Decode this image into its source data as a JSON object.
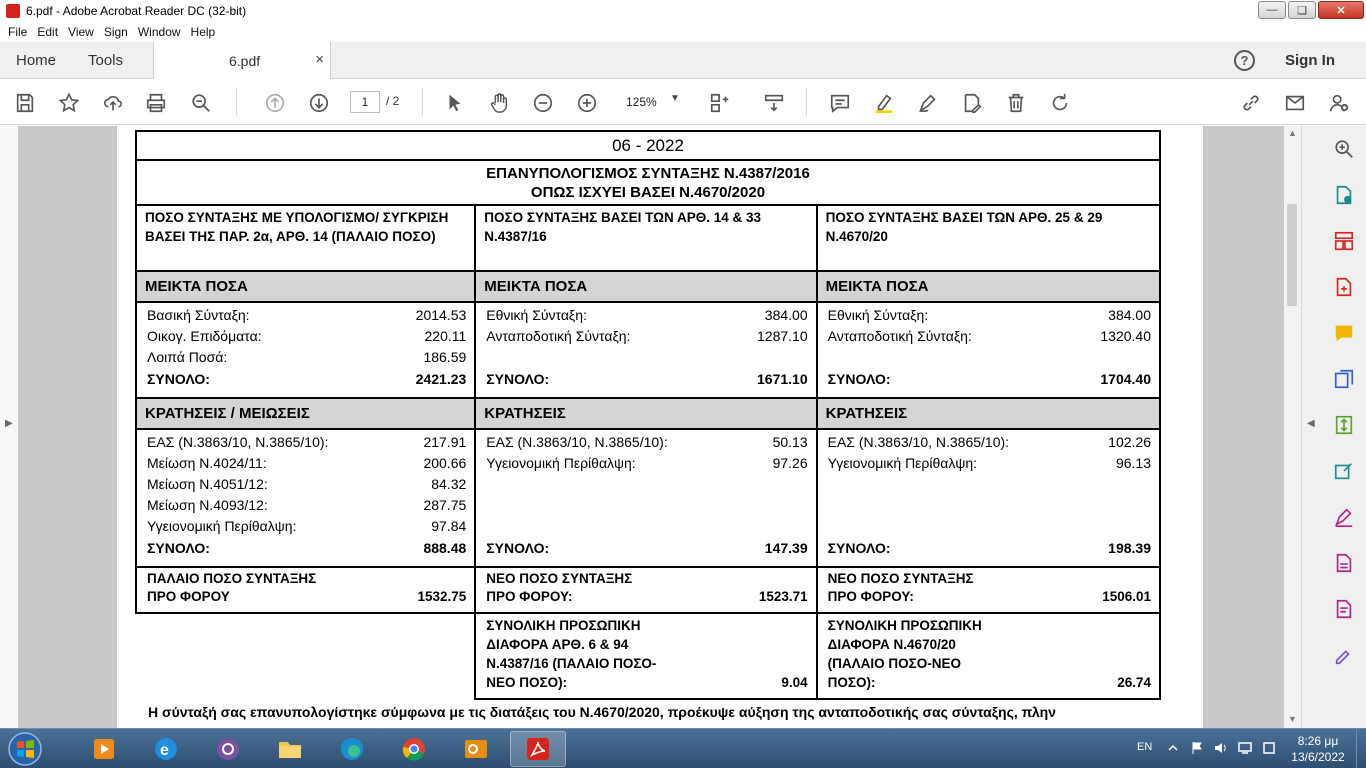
{
  "window": {
    "title": "6.pdf - Adobe Acrobat Reader DC (32-bit)"
  },
  "menu": [
    "File",
    "Edit",
    "View",
    "Sign",
    "Window",
    "Help"
  ],
  "tabs": {
    "home": "Home",
    "tools": "Tools",
    "document": "6.pdf",
    "close": "×"
  },
  "header": {
    "sign_in": "Sign In",
    "help": "?"
  },
  "toolbar": {
    "page_current": "1",
    "page_total": "/ 2",
    "zoom": "125%"
  },
  "form": {
    "date": "06 - 2022",
    "title_line1": "ΕΠΑΝΥΠΟΛΟΓΙΣΜΟΣ ΣΥΝΤΑΞΗΣ Ν.4387/2016",
    "title_line2": "ΟΠΩΣ ΙΣΧΥΕΙ ΒΑΣΕΙ Ν.4670/2020",
    "columns": [
      {
        "heading": "ΠΟΣΟ ΣΥΝΤΑΞΗΣ ΜΕ ΥΠΟΛΟΓΙΣΜΟ/ ΣΥΓΚΡΙΣΗ ΒΑΣΕΙ ΤΗΣ ΠΑΡ. 2α, ΑΡΘ. 14 (ΠΑΛΑΙΟ ΠΟΣΟ)",
        "gross_title": "ΜΕΙΚΤΑ ΠΟΣΑ",
        "gross": [
          {
            "label": "Βασική Σύνταξη:",
            "value": "2014.53"
          },
          {
            "label": "Οικογ. Επιδόματα:",
            "value": "220.11"
          },
          {
            "label": "Λοιπά Ποσά:",
            "value": "186.59"
          }
        ],
        "gross_total_label": "ΣΥΝΟΛΟ:",
        "gross_total": "2421.23",
        "deductions_title": "ΚΡΑΤΗΣΕΙΣ / ΜΕΙΩΣΕΙΣ",
        "deductions": [
          {
            "label": "ΕΑΣ (Ν.3863/10, Ν.3865/10):",
            "value": "217.91"
          },
          {
            "label": "Μείωση Ν.4024/11:",
            "value": "200.66"
          },
          {
            "label": "Μείωση Ν.4051/12:",
            "value": "84.32"
          },
          {
            "label": "Μείωση Ν.4093/12:",
            "value": "287.75"
          },
          {
            "label": "Υγειονομική Περίθαλψη:",
            "value": "97.84"
          }
        ],
        "deductions_total_label": "ΣΥΝΟΛΟ:",
        "deductions_total": "888.48",
        "net_line1": "ΠΑΛΑΙΟ ΠΟΣΟ ΣΥΝΤΑΞΗΣ",
        "net_line2": "ΠΡΟ ΦΟΡΟΥ",
        "net_value": "1532.75"
      },
      {
        "heading": "ΠΟΣΟ ΣΥΝΤΑΞΗΣ ΒΑΣΕΙ ΤΩΝ ΑΡΘ. 14 & 33 Ν.4387/16",
        "gross_title": "ΜΕΙΚΤΑ ΠΟΣΑ",
        "gross": [
          {
            "label": "Εθνική Σύνταξη:",
            "value": "384.00"
          },
          {
            "label": "Ανταποδοτική Σύνταξη:",
            "value": "1287.10"
          }
        ],
        "gross_total_label": "ΣΥΝΟΛΟ:",
        "gross_total": "1671.10",
        "deductions_title": "ΚΡΑΤΗΣΕΙΣ",
        "deductions": [
          {
            "label": "ΕΑΣ (Ν.3863/10, Ν.3865/10):",
            "value": "50.13"
          },
          {
            "label": "Υγειονομική Περίθαλψη:",
            "value": "97.26"
          }
        ],
        "deductions_total_label": "ΣΥΝΟΛΟ:",
        "deductions_total": "147.39",
        "net_line1": "ΝΕΟ ΠΟΣΟ ΣΥΝΤΑΞΗΣ",
        "net_line2": "ΠΡΟ ΦΟΡΟΥ:",
        "net_value": "1523.71",
        "diff_lines": [
          "ΣΥΝΟΛΙΚΗ ΠΡΟΣΩΠΙΚΗ",
          "ΔΙΑΦΟΡΑ ΑΡΘ. 6 & 94",
          "Ν.4387/16 (ΠΑΛΑΙΟ ΠΟΣΟ-",
          "ΝΕΟ ΠΟΣΟ):"
        ],
        "diff_value": "9.04"
      },
      {
        "heading": "ΠΟΣΟ ΣΥΝΤΑΞΗΣ ΒΑΣΕΙ ΤΩΝ ΑΡΘ. 25 & 29 Ν.4670/20",
        "gross_title": "ΜΕΙΚΤΑ ΠΟΣΑ",
        "gross": [
          {
            "label": "Εθνική Σύνταξη:",
            "value": "384.00"
          },
          {
            "label": "Ανταποδοτική Σύνταξη:",
            "value": "1320.40"
          }
        ],
        "gross_total_label": "ΣΥΝΟΛΟ:",
        "gross_total": "1704.40",
        "deductions_title": "ΚΡΑΤΗΣΕΙΣ",
        "deductions": [
          {
            "label": "ΕΑΣ (Ν.3863/10, Ν.3865/10):",
            "value": "102.26"
          },
          {
            "label": "Υγειονομική Περίθαλψη:",
            "value": "96.13"
          }
        ],
        "deductions_total_label": "ΣΥΝΟΛΟ:",
        "deductions_total": "198.39",
        "net_line1": "ΝΕΟ ΠΟΣΟ ΣΥΝΤΑΞΗΣ",
        "net_line2": "ΠΡΟ ΦΟΡΟΥ:",
        "net_value": "1506.01",
        "diff_lines": [
          "ΣΥΝΟΛΙΚΗ ΠΡΟΣΩΠΙΚΗ",
          "ΔΙΑΦΟΡΑ Ν.4670/20",
          "(ΠΑΛΑΙΟ ΠΟΣΟ-ΝΕΟ",
          "ΠΟΣΟ):"
        ],
        "diff_value": "26.74"
      }
    ],
    "note": "Η σύνταξή σας επανυπολογίστηκε σύμφωνα με τις διατάξεις του Ν.4670/2020, προέκυψε αύξηση της ανταποδοτικής σας σύνταξης, πλην"
  },
  "taskbar": {
    "lang": "EN",
    "time": "8:26 μμ",
    "date": "13/6/2022"
  },
  "colors": {
    "accent": "#1473e6",
    "acrobat_red": "#d8221c",
    "table_grey": "#d4d4d4"
  }
}
